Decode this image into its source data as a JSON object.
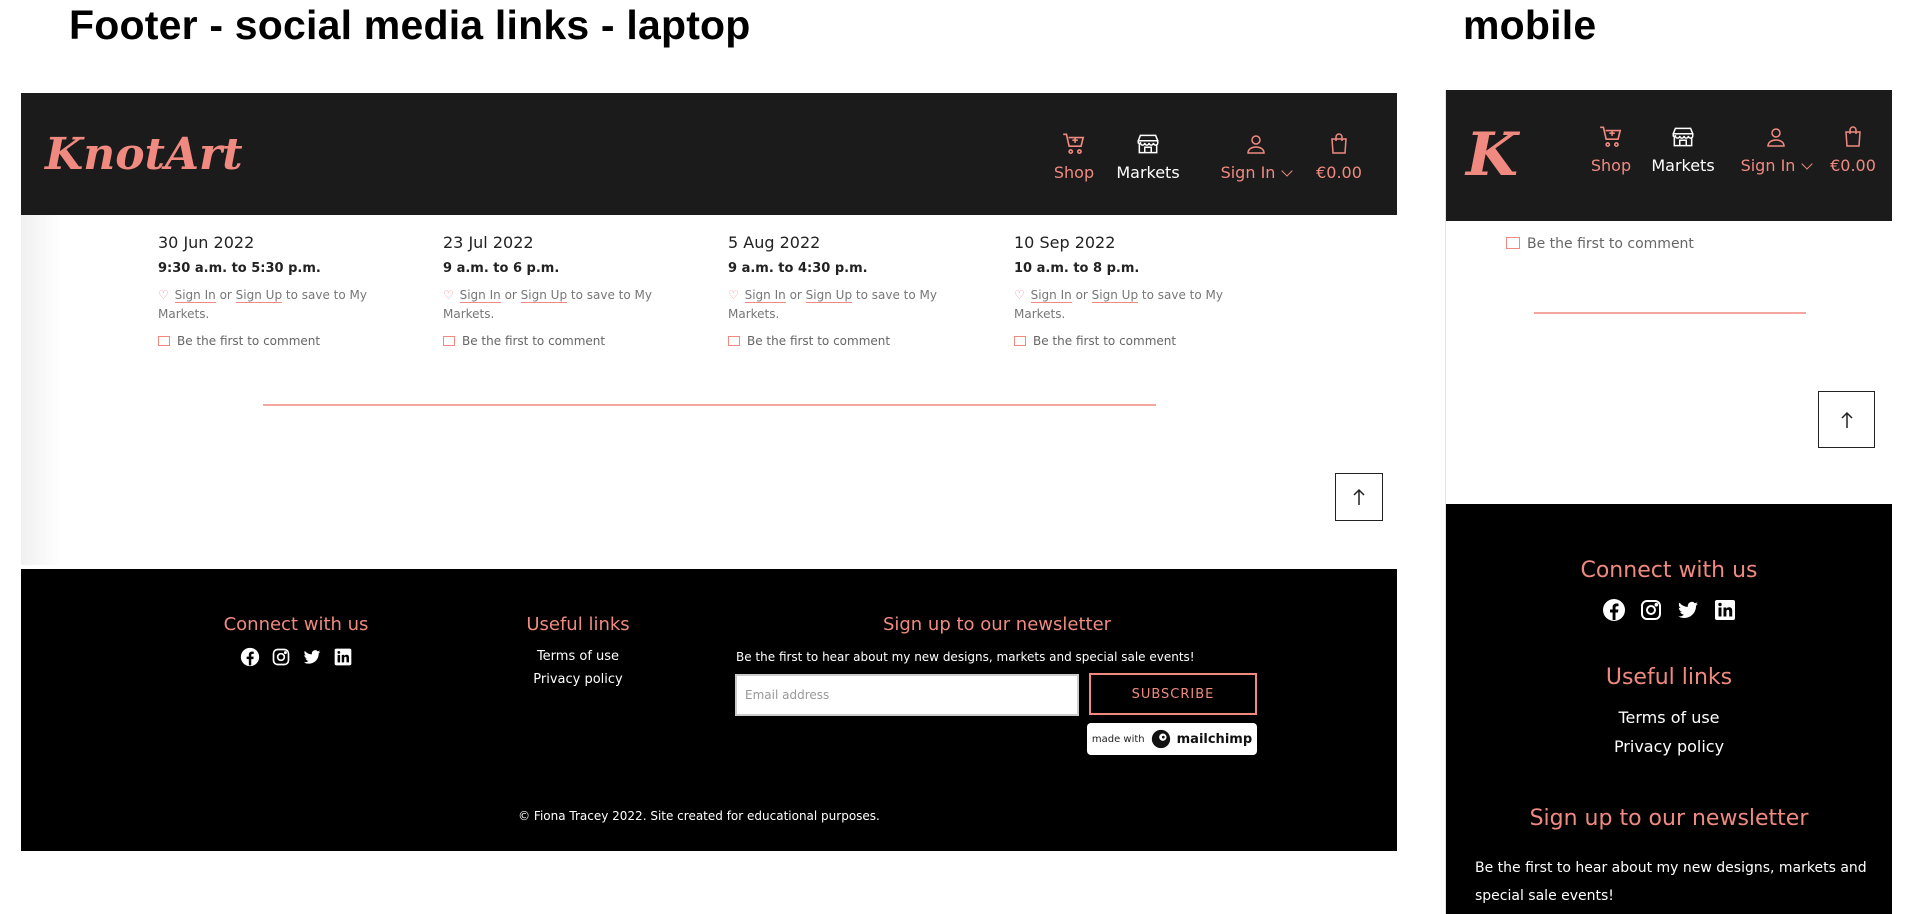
{
  "headings": {
    "laptop": "Footer - social media links - laptop",
    "mobile": "mobile"
  },
  "brand": {
    "logo_full": "KnotArt",
    "logo_short": "K"
  },
  "nav": {
    "shop": "Shop",
    "markets": "Markets",
    "sign_in": "Sign In",
    "cart": "€0.00"
  },
  "events": [
    {
      "date": "30 Jun 2022",
      "time": "9:30 a.m. to 5:30 p.m.",
      "sign_in": "Sign In",
      "or": "or",
      "sign_up": "Sign Up",
      "save_text": "to save to My Markets.",
      "comment": "Be the first to comment"
    },
    {
      "date": "23 Jul 2022",
      "time": "9 a.m. to 6 p.m.",
      "sign_in": "Sign In",
      "or": "or",
      "sign_up": "Sign Up",
      "save_text": "to save to My Markets.",
      "comment": "Be the first to comment"
    },
    {
      "date": "5 Aug 2022",
      "time": "9 a.m. to 4:30 p.m.",
      "sign_in": "Sign In",
      "or": "or",
      "sign_up": "Sign Up",
      "save_text": "to save to My Markets.",
      "comment": "Be the first to comment"
    },
    {
      "date": "10 Sep 2022",
      "time": "10 a.m. to 8 p.m.",
      "sign_in": "Sign In",
      "or": "or",
      "sign_up": "Sign Up",
      "save_text": "to save to My Markets.",
      "comment": "Be the first to comment"
    }
  ],
  "mobile_comment": "Be the first to comment",
  "back_to_top_icon": "arrow-up-icon",
  "footer": {
    "connect_title": "Connect with us",
    "social_icons": [
      "facebook-icon",
      "instagram-icon",
      "twitter-icon",
      "linkedin-icon"
    ],
    "useful_title": "Useful links",
    "links": [
      "Terms of use",
      "Privacy policy"
    ],
    "newsletter_title": "Sign up to our newsletter",
    "newsletter_text": "Be the first to hear about my new designs, markets and special sale events!",
    "mobile_newsletter_line1": "Be the first to hear about my new designs, markets and",
    "mobile_newsletter_line2": "special sale events!",
    "email_placeholder": "Email address",
    "subscribe_label": "SUBSCRIBE",
    "mailchimp_made_with": "made with",
    "mailchimp_name": "mailchimp",
    "copyright": "© Fiona Tracey 2022. Site created for educational purposes."
  },
  "colors": {
    "accent": "#f08a80",
    "nav_bg": "#1b1b1b",
    "footer_bg": "#000000"
  }
}
